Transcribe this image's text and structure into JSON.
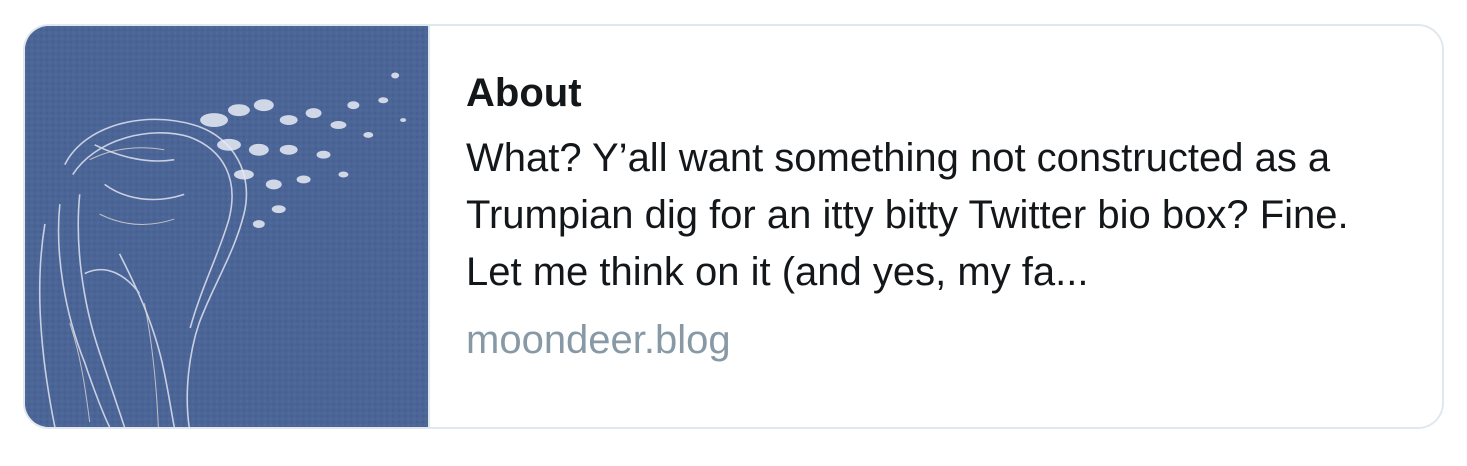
{
  "card": {
    "title": "About",
    "description": "What? Y’all want something not constructed as a Trumpian dig for an itty bitty Twitter bio box? Fine. Let me think on it (and yes, my fa...",
    "domain": "moondeer.blog",
    "image": {
      "icon": "deer-illustration-image",
      "background_color": "#4a6396"
    }
  },
  "colors": {
    "border": "#e1e8ed",
    "text": "#14171a",
    "muted": "#8899a6"
  }
}
